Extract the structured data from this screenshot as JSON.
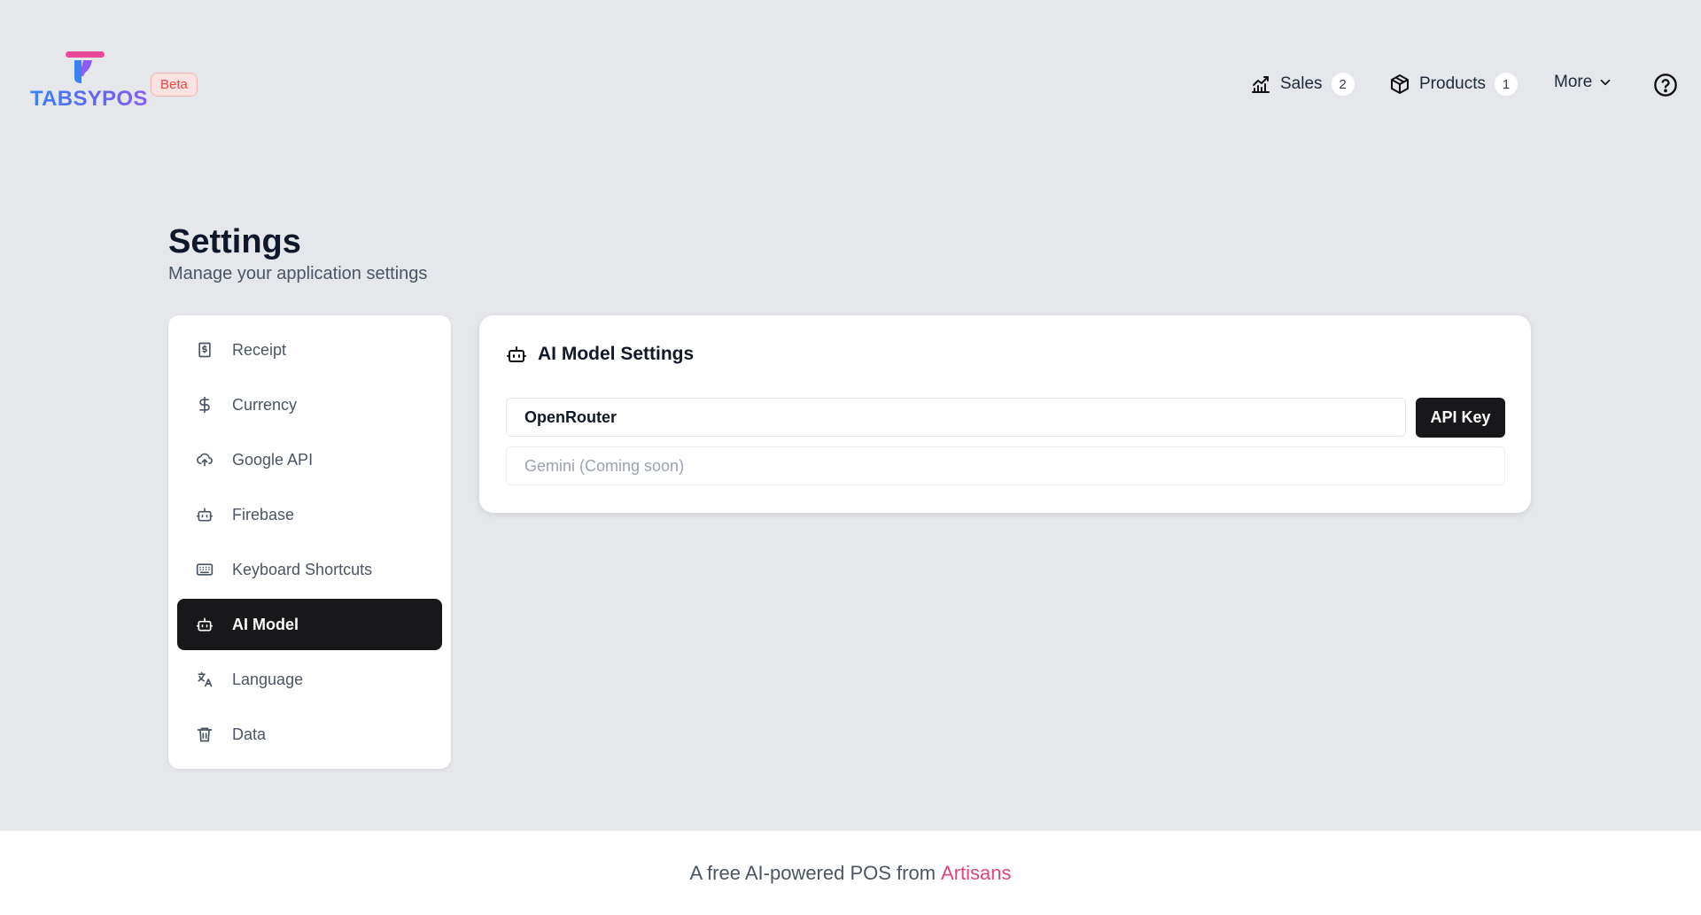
{
  "brand": {
    "name": "TABSYPOS",
    "badge": "Beta"
  },
  "nav": {
    "sales": {
      "label": "Sales",
      "count": "2"
    },
    "products": {
      "label": "Products",
      "count": "1"
    },
    "more": {
      "label": "More"
    }
  },
  "page": {
    "title": "Settings",
    "subtitle": "Manage your application settings"
  },
  "sidebar": {
    "items": [
      {
        "label": "Receipt",
        "icon": "receipt-icon"
      },
      {
        "label": "Currency",
        "icon": "dollar-icon"
      },
      {
        "label": "Google API",
        "icon": "cloud-upload-icon"
      },
      {
        "label": "Firebase",
        "icon": "bot-icon"
      },
      {
        "label": "Keyboard Shortcuts",
        "icon": "keyboard-icon"
      },
      {
        "label": "AI Model",
        "icon": "bot-icon",
        "active": true
      },
      {
        "label": "Language",
        "icon": "translate-icon"
      },
      {
        "label": "Data",
        "icon": "trash-icon"
      }
    ]
  },
  "card": {
    "title": "AI Model Settings",
    "option_primary": "OpenRouter",
    "api_key_button": "API Key",
    "option_secondary": "Gemini (Coming soon)"
  },
  "footer": {
    "text": "A free AI-powered POS from",
    "link": "Artisans"
  },
  "colors": {
    "accent_dark": "#18181b",
    "footer_link": "#e0457b",
    "beta": "#ef4444",
    "background": "#e5e7eb"
  }
}
